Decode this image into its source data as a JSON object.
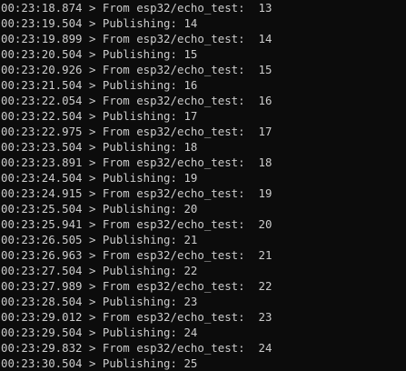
{
  "terminal": {
    "lines": [
      {
        "time": "00:23:18.874",
        "sep": " > ",
        "msg": "From esp32/echo_test:  13"
      },
      {
        "time": "00:23:19.504",
        "sep": " > ",
        "msg": "Publishing: 14"
      },
      {
        "time": "00:23:19.899",
        "sep": " > ",
        "msg": "From esp32/echo_test:  14"
      },
      {
        "time": "00:23:20.504",
        "sep": " > ",
        "msg": "Publishing: 15"
      },
      {
        "time": "00:23:20.926",
        "sep": " > ",
        "msg": "From esp32/echo_test:  15"
      },
      {
        "time": "00:23:21.504",
        "sep": " > ",
        "msg": "Publishing: 16"
      },
      {
        "time": "00:23:22.054",
        "sep": " > ",
        "msg": "From esp32/echo_test:  16"
      },
      {
        "time": "00:23:22.504",
        "sep": " > ",
        "msg": "Publishing: 17"
      },
      {
        "time": "00:23:22.975",
        "sep": " > ",
        "msg": "From esp32/echo_test:  17"
      },
      {
        "time": "00:23:23.504",
        "sep": " > ",
        "msg": "Publishing: 18"
      },
      {
        "time": "00:23:23.891",
        "sep": " > ",
        "msg": "From esp32/echo_test:  18"
      },
      {
        "time": "00:23:24.504",
        "sep": " > ",
        "msg": "Publishing: 19"
      },
      {
        "time": "00:23:24.915",
        "sep": " > ",
        "msg": "From esp32/echo_test:  19"
      },
      {
        "time": "00:23:25.504",
        "sep": " > ",
        "msg": "Publishing: 20"
      },
      {
        "time": "00:23:25.941",
        "sep": " > ",
        "msg": "From esp32/echo_test:  20"
      },
      {
        "time": "00:23:26.505",
        "sep": " > ",
        "msg": "Publishing: 21"
      },
      {
        "time": "00:23:26.963",
        "sep": " > ",
        "msg": "From esp32/echo_test:  21"
      },
      {
        "time": "00:23:27.504",
        "sep": " > ",
        "msg": "Publishing: 22"
      },
      {
        "time": "00:23:27.989",
        "sep": " > ",
        "msg": "From esp32/echo_test:  22"
      },
      {
        "time": "00:23:28.504",
        "sep": " > ",
        "msg": "Publishing: 23"
      },
      {
        "time": "00:23:29.012",
        "sep": " > ",
        "msg": "From esp32/echo_test:  23"
      },
      {
        "time": "00:23:29.504",
        "sep": " > ",
        "msg": "Publishing: 24"
      },
      {
        "time": "00:23:29.832",
        "sep": " > ",
        "msg": "From esp32/echo_test:  24"
      },
      {
        "time": "00:23:30.504",
        "sep": " > ",
        "msg": "Publishing: 25"
      }
    ]
  },
  "colors": {
    "background": "#0c0c0c",
    "text": "#cccccc"
  }
}
